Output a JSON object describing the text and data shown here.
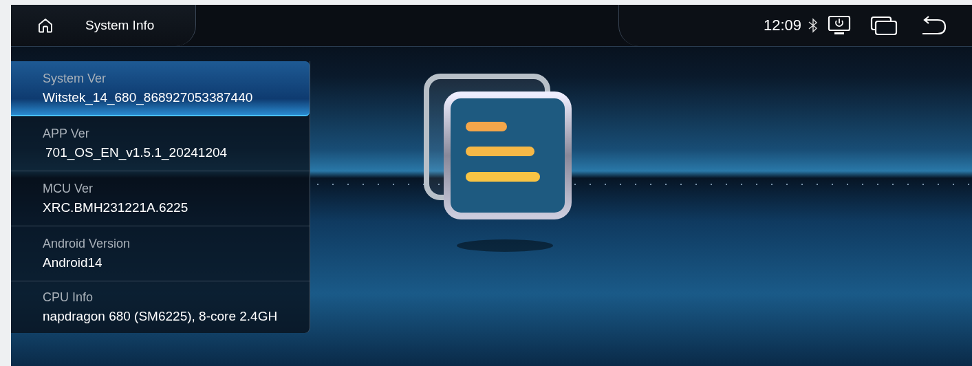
{
  "top_bar": {
    "title": "System Info",
    "time": "12:09"
  },
  "info_list": [
    {
      "label": "System Ver",
      "value": "Witstek_14_680_868927053387440",
      "selected": true
    },
    {
      "label": "APP Ver",
      "value": "701_OS_EN_v1.5.1_20241204",
      "selected": false
    },
    {
      "label": "MCU Ver",
      "value": "XRC.BMH231221A.6225",
      "selected": false
    },
    {
      "label": "Android Version",
      "value": "Android14",
      "selected": false
    },
    {
      "label": "CPU Info",
      "value": "napdragon 680 (SM6225), 8-core 2.4GH",
      "selected": false
    }
  ]
}
